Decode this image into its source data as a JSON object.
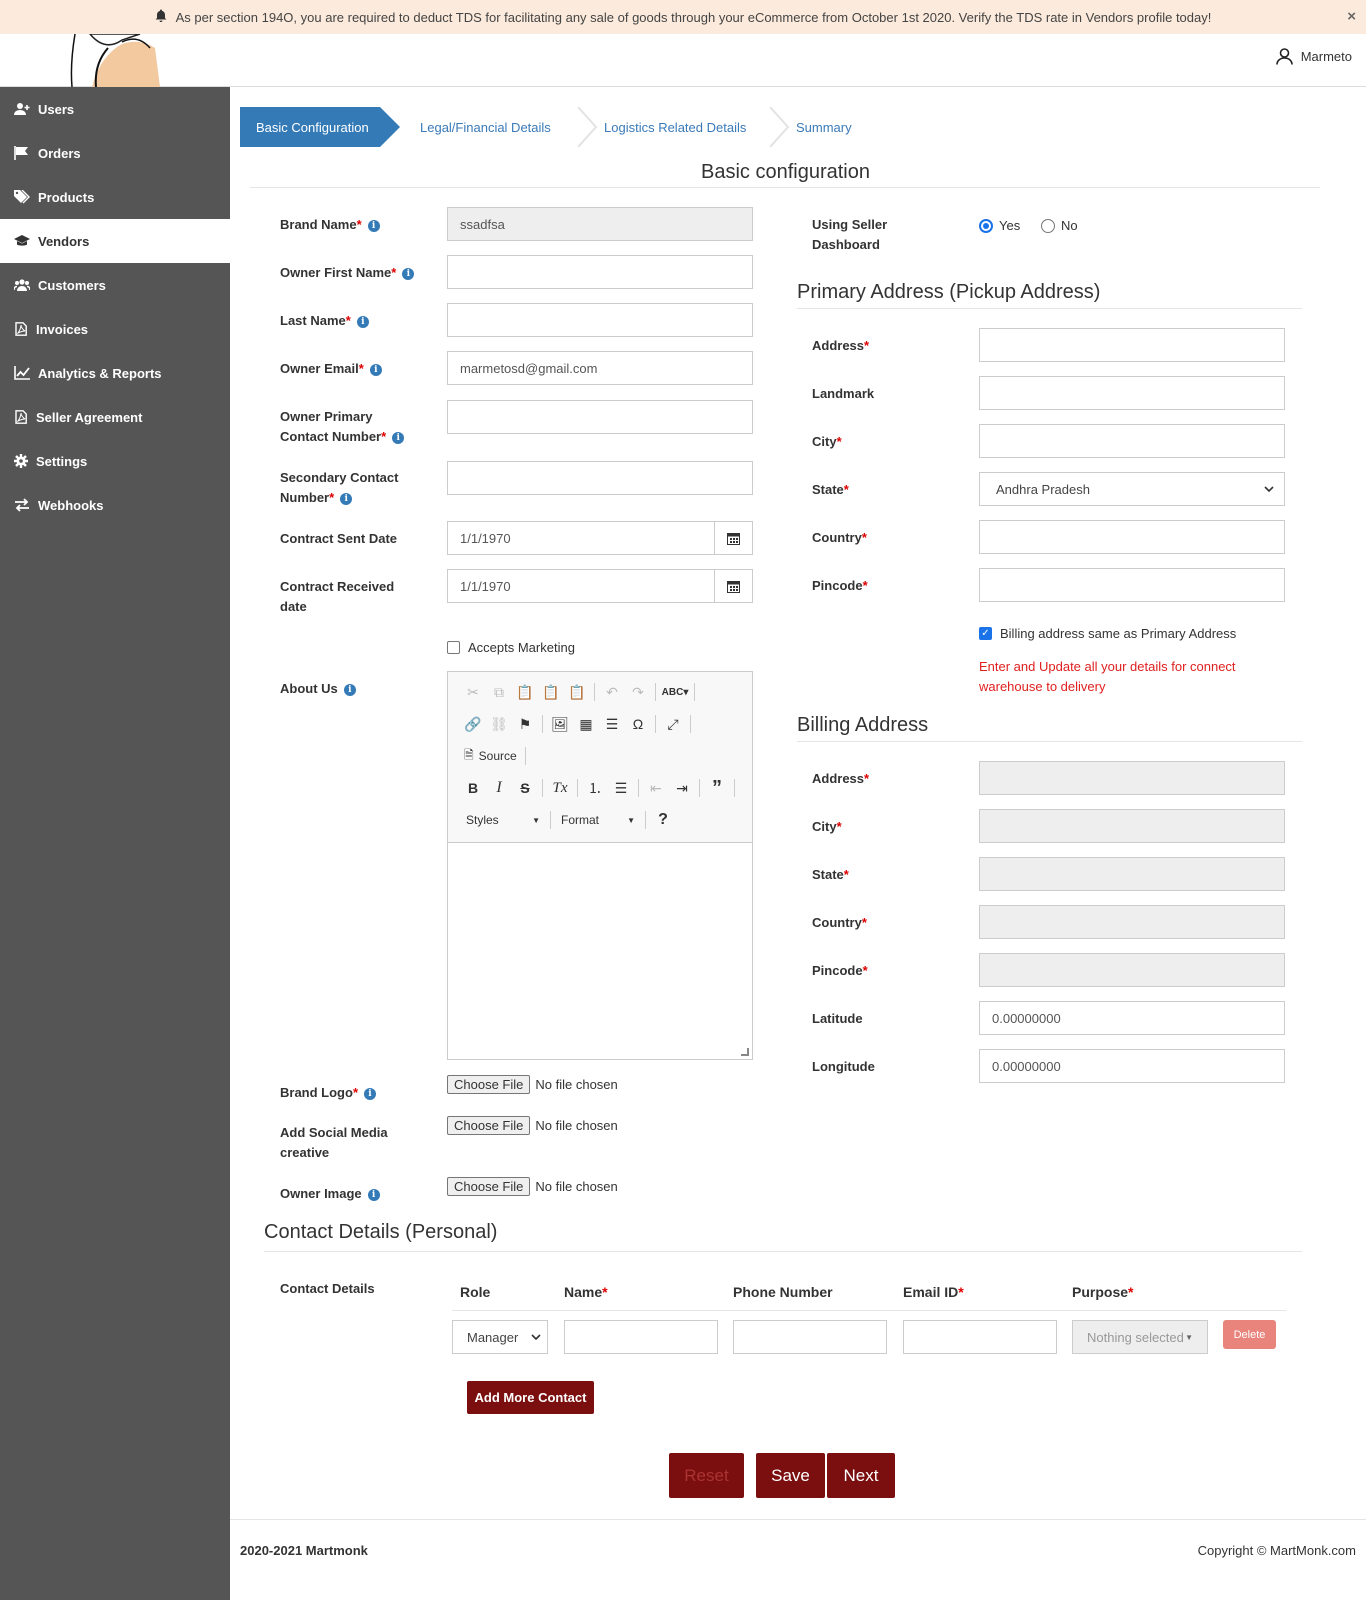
{
  "announcement": {
    "text": "As per section 194O, you are required to deduct TDS for facilitating any sale of goods through your eCommerce from October 1st 2020. Verify the TDS rate in Vendors profile today!",
    "close": "×"
  },
  "header": {
    "user_name": "Marmeto"
  },
  "sidebar": {
    "items": [
      {
        "label": "Users",
        "icon": "users-icon"
      },
      {
        "label": "Orders",
        "icon": "flag-icon"
      },
      {
        "label": "Products",
        "icon": "tags-icon"
      },
      {
        "label": "Vendors",
        "icon": "graduation-cap-icon",
        "active": true
      },
      {
        "label": "Customers",
        "icon": "users-group-icon"
      },
      {
        "label": "Invoices",
        "icon": "pdf-file-icon"
      },
      {
        "label": "Analytics & Reports",
        "icon": "line-chart-icon"
      },
      {
        "label": "Seller Agreement",
        "icon": "pdf-file-icon"
      },
      {
        "label": "Settings",
        "icon": "gear-icon"
      },
      {
        "label": "Webhooks",
        "icon": "exchange-icon"
      }
    ]
  },
  "stepper": {
    "steps": [
      "Basic Configuration",
      "Legal/Financial Details",
      "Logistics Related Details",
      "Summary"
    ],
    "active_color": "#337ab7"
  },
  "basic": {
    "title": "Basic configuration",
    "brand_name_label": "Brand Name",
    "brand_name_value": "ssadfsa",
    "owner_first_name_label": "Owner First Name",
    "last_name_label": "Last Name",
    "owner_email_label": "Owner Email",
    "owner_email_value": "marmetosd@gmail.com",
    "owner_primary_label_1": "Owner Primary",
    "owner_primary_label_2": "Contact Number",
    "secondary_label_1": "Secondary Contact",
    "secondary_label_2": "Number",
    "contract_sent_label": "Contract Sent Date",
    "contract_sent_value": "1/1/1970",
    "contract_received_label_1": "Contract Received",
    "contract_received_label_2": "date",
    "contract_received_value": "1/1/1970",
    "accepts_marketing": "Accepts Marketing",
    "about_us_label": "About Us",
    "brand_logo_label": "Brand Logo",
    "social_label_1": "Add Social Media",
    "social_label_2": "creative",
    "owner_image_label": "Owner Image",
    "choose_file": "Choose File",
    "no_file": "No file chosen"
  },
  "editor": {
    "source_label": "Source",
    "styles_label": "Styles",
    "format_label": "Format"
  },
  "seller_dashboard": {
    "label_1": "Using Seller",
    "label_2": "Dashboard",
    "yes": "Yes",
    "no": "No"
  },
  "primary_address": {
    "title": "Primary Address (Pickup Address)",
    "address": "Address",
    "landmark": "Landmark",
    "city": "City",
    "state": "State",
    "state_value": "Andhra Pradesh",
    "country": "Country",
    "pincode": "Pincode",
    "billing_same": "Billing address same as Primary Address",
    "note_1": "Enter and Update all your details for connect",
    "note_2": "warehouse to delivery"
  },
  "billing_address": {
    "title": "Billing Address",
    "address": "Address",
    "city": "City",
    "state": "State",
    "country": "Country",
    "pincode": "Pincode",
    "latitude": "Latitude",
    "latitude_value": "0.00000000",
    "longitude": "Longitude",
    "longitude_value": "0.00000000"
  },
  "contacts": {
    "title": "Contact Details (Personal)",
    "row_label": "Contact Details",
    "columns": [
      "Role",
      "Name",
      "Phone Number",
      "Email ID",
      "Purpose"
    ],
    "role_value": "Manager",
    "purpose_placeholder": "Nothing selected",
    "delete": "Delete",
    "add_more": "Add More Contact"
  },
  "actions": {
    "reset": "Reset",
    "save": "Save",
    "next": "Next"
  },
  "footer": {
    "left": "2020-2021 Martmonk",
    "right": "Copyright © MartMonk.com"
  },
  "colors": {
    "brand_dark": "#7b0f0f",
    "sidebar": "#555555",
    "required": "#dd0000",
    "note": "#e02020"
  }
}
